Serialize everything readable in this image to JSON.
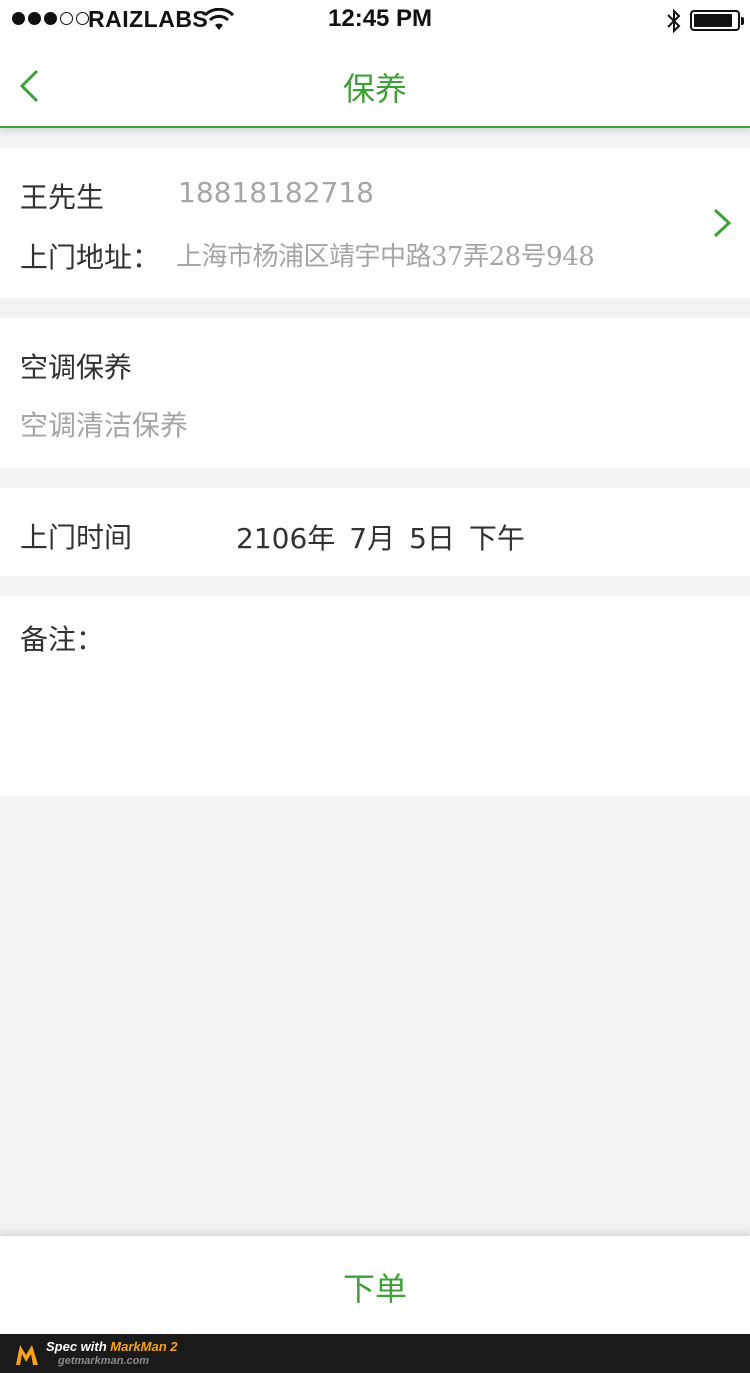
{
  "status_bar": {
    "carrier": "RAIZLABS",
    "time": "12:45 PM",
    "signal_icon": "signal-dots-icon",
    "wifi_icon": "wifi-icon",
    "bluetooth_icon": "bluetooth-icon",
    "battery_icon": "battery-icon"
  },
  "navbar": {
    "title": "保养",
    "back_icon": "chevron-left-icon"
  },
  "contact": {
    "name": "王先生",
    "phone": "18818182718",
    "address_label": "上门地址：",
    "address_value": "上海市杨浦区靖宇中路37弄28号948",
    "chevron_icon": "chevron-right-icon"
  },
  "service": {
    "category": "空调保养",
    "item": "空调清洁保养"
  },
  "visit_time": {
    "label": "上门时间",
    "year": "2106年",
    "month": "7月",
    "day": "5日",
    "period": "下午"
  },
  "remark": {
    "label": "备注："
  },
  "submit": {
    "label": "下单"
  },
  "footer": {
    "spec_with": "Spec with ",
    "brand": "MarkMan 2",
    "url": "getmarkman.com"
  },
  "colors": {
    "accent": "#3fa037",
    "text": "#323232",
    "secondary_text": "#a4a5a4",
    "background": "#f2f2f2",
    "card": "#ffffff",
    "shadow": "#a8a8a8"
  }
}
